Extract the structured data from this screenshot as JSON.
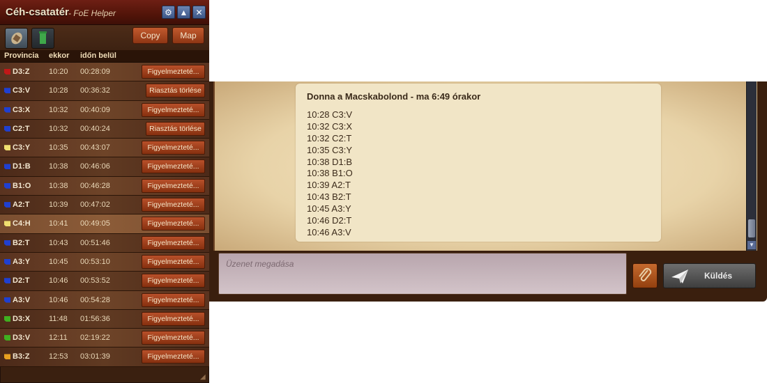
{
  "panel": {
    "title": "Céh-csatatér",
    "subtitle": "- FoE Helper",
    "buttons": {
      "copy": "Copy",
      "map": "Map"
    },
    "columns": {
      "province": "Provincia",
      "when": "ekkor",
      "within": "időn belül"
    },
    "rows": [
      {
        "province": "D3:Z",
        "time": "10:20",
        "remaining": "00:28:09",
        "action": "Figyelmezteté...",
        "color": "#c01818"
      },
      {
        "province": "C3:V",
        "time": "10:28",
        "remaining": "00:36:32",
        "action": "Riasztás törlése",
        "color": "#2040d0"
      },
      {
        "province": "C3:X",
        "time": "10:32",
        "remaining": "00:40:09",
        "action": "Figyelmezteté...",
        "color": "#2040d0"
      },
      {
        "province": "C2:T",
        "time": "10:32",
        "remaining": "00:40:24",
        "action": "Riasztás törlése",
        "color": "#2040d0"
      },
      {
        "province": "C3:Y",
        "time": "10:35",
        "remaining": "00:43:07",
        "action": "Figyelmezteté...",
        "color": "#f0e070"
      },
      {
        "province": "D1:B",
        "time": "10:38",
        "remaining": "00:46:06",
        "action": "Figyelmezteté...",
        "color": "#2040d0"
      },
      {
        "province": "B1:O",
        "time": "10:38",
        "remaining": "00:46:28",
        "action": "Figyelmezteté...",
        "color": "#2040d0"
      },
      {
        "province": "A2:T",
        "time": "10:39",
        "remaining": "00:47:02",
        "action": "Figyelmezteté...",
        "color": "#2040d0"
      },
      {
        "province": "C4:H",
        "time": "10:41",
        "remaining": "00:49:05",
        "action": "Figyelmezteté...",
        "color": "#f0e070"
      },
      {
        "province": "B2:T",
        "time": "10:43",
        "remaining": "00:51:46",
        "action": "Figyelmezteté...",
        "color": "#2040d0"
      },
      {
        "province": "A3:Y",
        "time": "10:45",
        "remaining": "00:53:10",
        "action": "Figyelmezteté...",
        "color": "#2040d0"
      },
      {
        "province": "D2:T",
        "time": "10:46",
        "remaining": "00:53:52",
        "action": "Figyelmezteté...",
        "color": "#2040d0"
      },
      {
        "province": "A3:V",
        "time": "10:46",
        "remaining": "00:54:28",
        "action": "Figyelmezteté...",
        "color": "#2040d0"
      },
      {
        "province": "D3:X",
        "time": "11:48",
        "remaining": "01:56:36",
        "action": "Figyelmezteté...",
        "color": "#40b020"
      },
      {
        "province": "D3:V",
        "time": "12:11",
        "remaining": "02:19:22",
        "action": "Figyelmezteté...",
        "color": "#40b020"
      },
      {
        "province": "B3:Z",
        "time": "12:53",
        "remaining": "03:01:39",
        "action": "Figyelmezteté...",
        "color": "#e8a020"
      }
    ]
  },
  "chat": {
    "author_line": "Donna a Macskabolond - ma 6:49 órakor",
    "lines": [
      "10:28 C3:V",
      "10:32 C3:X",
      "10:32 C2:T",
      "10:35 C3:Y",
      "10:38 D1:B",
      "10:38 B1:O",
      "10:39 A2:T",
      "10:43 B2:T",
      "10:45 A3:Y",
      "10:46 D2:T",
      "10:46 A3:V"
    ],
    "input_placeholder": "Üzenet megadása",
    "send_label": "Küldés"
  }
}
